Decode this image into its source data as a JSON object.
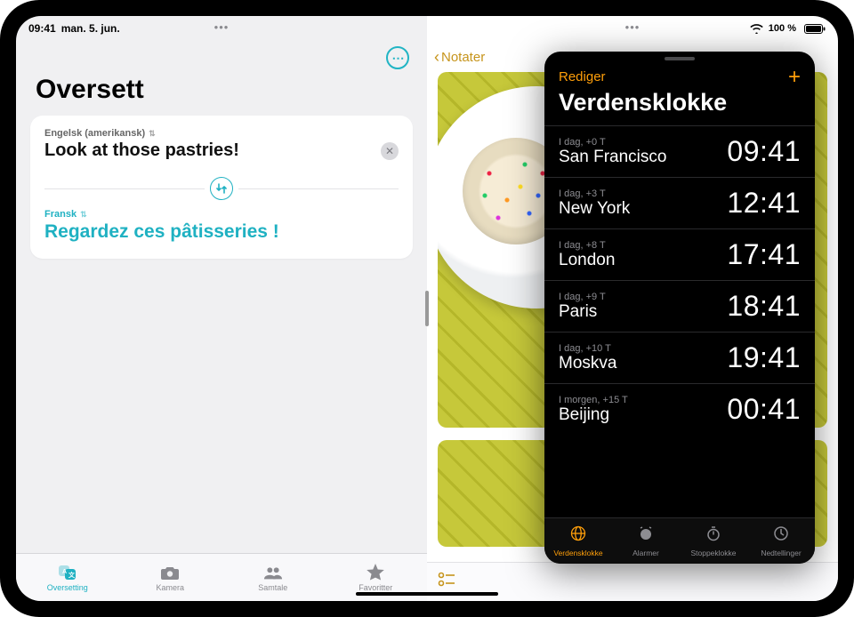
{
  "status": {
    "time": "09:41",
    "date": "man. 5. jun.",
    "battery": "100 %"
  },
  "translate": {
    "title": "Oversett",
    "source_lang": "Engelsk (amerikansk)",
    "source_text": "Look at those pastries!",
    "target_lang": "Fransk",
    "target_text": "Regardez ces pâtisseries !",
    "tabs": {
      "translate": "Oversetting",
      "camera": "Kamera",
      "conversation": "Samtale",
      "favorites": "Favoritter"
    }
  },
  "notes": {
    "back": "Notater"
  },
  "clock": {
    "edit": "Rediger",
    "title": "Verdensklokke",
    "rows": [
      {
        "meta": "I dag, +0 T",
        "city": "San Francisco",
        "time": "09:41"
      },
      {
        "meta": "I dag, +3 T",
        "city": "New York",
        "time": "12:41"
      },
      {
        "meta": "I dag, +8 T",
        "city": "London",
        "time": "17:41"
      },
      {
        "meta": "I dag, +9 T",
        "city": "Paris",
        "time": "18:41"
      },
      {
        "meta": "I dag, +10 T",
        "city": "Moskva",
        "time": "19:41"
      },
      {
        "meta": "I morgen, +15 T",
        "city": "Beijing",
        "time": "00:41"
      }
    ],
    "tabs": {
      "world": "Verdensklokke",
      "alarm": "Alarmer",
      "stopwatch": "Stoppeklokke",
      "timer": "Nedtellinger"
    }
  }
}
